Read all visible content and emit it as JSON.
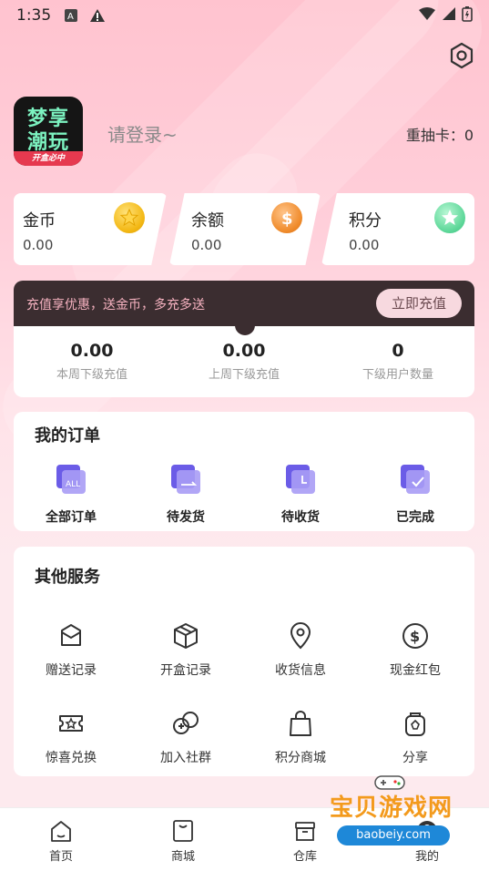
{
  "status_bar": {
    "time": "1:35"
  },
  "profile": {
    "logo_lines": [
      "梦享",
      "潮玩"
    ],
    "logo_tag": "开盒必中",
    "login_prompt": "请登录~",
    "redraw_card": "重抽卡：0"
  },
  "wallet": [
    {
      "label": "金币",
      "value": "0.00",
      "icon": "gold-coin-icon",
      "color": "#f6c12a"
    },
    {
      "label": "余额",
      "value": "0.00",
      "icon": "balance-coin-icon",
      "color": "#f29a3a"
    },
    {
      "label": "积分",
      "value": "0.00",
      "icon": "points-star-icon",
      "color": "#5fd89a"
    }
  ],
  "promo": {
    "text": "充值享优惠，送金币，多充多送",
    "button": "立即充值",
    "stats": [
      {
        "value": "0.00",
        "label": "本周下级充值"
      },
      {
        "value": "0.00",
        "label": "上周下级充值"
      },
      {
        "value": "0",
        "label": "下级用户数量"
      }
    ]
  },
  "orders": {
    "title": "我的订单",
    "items": [
      {
        "label": "全部订单",
        "icon": "all-orders-icon"
      },
      {
        "label": "待发货",
        "icon": "pending-shipment-icon"
      },
      {
        "label": "待收货",
        "icon": "pending-receipt-icon"
      },
      {
        "label": "已完成",
        "icon": "completed-icon"
      }
    ]
  },
  "services": {
    "title": "其他服务",
    "items": [
      {
        "label": "赠送记录",
        "icon": "gift-record-icon"
      },
      {
        "label": "开盒记录",
        "icon": "box-record-icon"
      },
      {
        "label": "收货信息",
        "icon": "location-icon"
      },
      {
        "label": "现金红包",
        "icon": "dollar-icon"
      },
      {
        "label": "惊喜兑换",
        "icon": "ticket-icon"
      },
      {
        "label": "加入社群",
        "icon": "community-icon"
      },
      {
        "label": "积分商城",
        "icon": "shopping-bag-icon"
      },
      {
        "label": "分享",
        "icon": "share-icon"
      }
    ]
  },
  "tabbar": [
    {
      "label": "首页",
      "icon": "home-icon"
    },
    {
      "label": "商城",
      "icon": "mall-icon"
    },
    {
      "label": "仓库",
      "icon": "warehouse-icon"
    },
    {
      "label": "我的",
      "icon": "mine-icon"
    }
  ],
  "watermark": {
    "title": "宝贝游戏网",
    "url": "baobeiy.com"
  },
  "colors": {
    "accent_pink": "#ffc3cf",
    "promo_dark": "#3b2d30",
    "order_purple": "#7a6cf0"
  }
}
